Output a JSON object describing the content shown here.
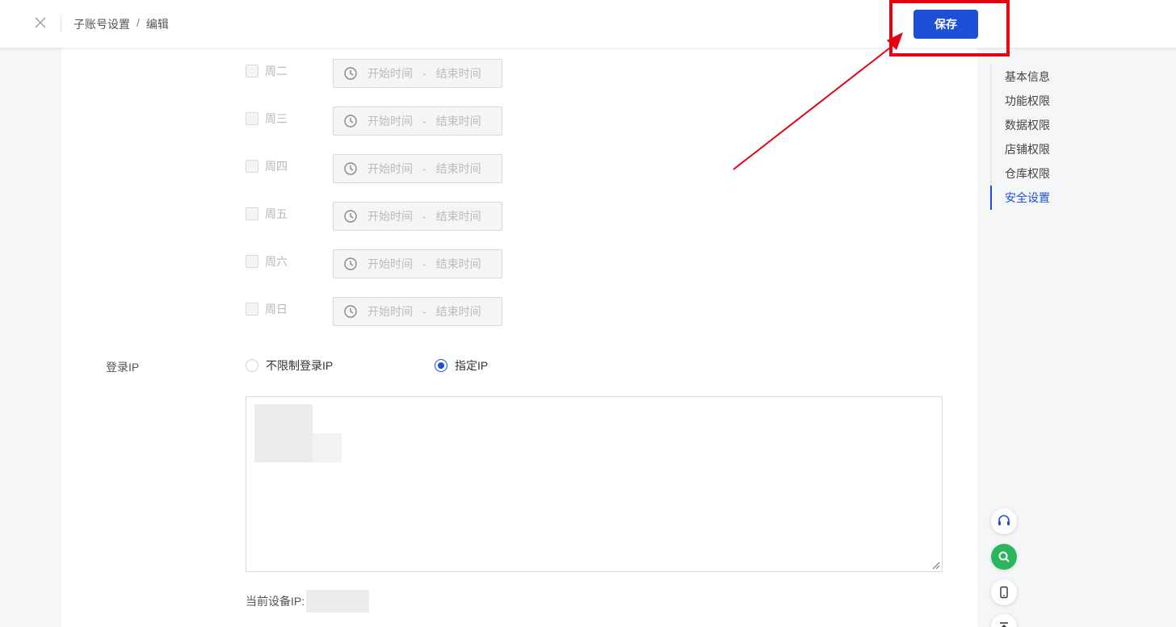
{
  "header": {
    "breadcrumb": [
      "子账号设置",
      "编辑"
    ],
    "breadcrumb_sep": "/",
    "save_label": "保存"
  },
  "schedule": {
    "rows": [
      {
        "day": "周二",
        "start_placeholder": "开始时间",
        "end_placeholder": "结束时间"
      },
      {
        "day": "周三",
        "start_placeholder": "开始时间",
        "end_placeholder": "结束时间"
      },
      {
        "day": "周四",
        "start_placeholder": "开始时间",
        "end_placeholder": "结束时间"
      },
      {
        "day": "周五",
        "start_placeholder": "开始时间",
        "end_placeholder": "结束时间"
      },
      {
        "day": "周六",
        "start_placeholder": "开始时间",
        "end_placeholder": "结束时间"
      },
      {
        "day": "周日",
        "start_placeholder": "开始时间",
        "end_placeholder": "结束时间"
      }
    ],
    "range_sep": "-"
  },
  "login_ip": {
    "label": "登录IP",
    "options": [
      {
        "label": "不限制登录IP",
        "checked": false
      },
      {
        "label": "指定IP",
        "checked": true
      }
    ],
    "device_ip_label": "当前设备IP:"
  },
  "anchor_nav": {
    "items": [
      {
        "label": "基本信息",
        "active": false
      },
      {
        "label": "功能权限",
        "active": false
      },
      {
        "label": "数据权限",
        "active": false
      },
      {
        "label": "店铺权限",
        "active": false
      },
      {
        "label": "仓库权限",
        "active": false
      },
      {
        "label": "安全设置",
        "active": true
      }
    ]
  },
  "floating_tools": [
    "headset-icon",
    "search-icon",
    "phone-icon",
    "back-to-top-icon"
  ],
  "colors": {
    "primary": "#1d4fd7",
    "annotation_red": "#e60012",
    "search_green": "#2db55d"
  }
}
